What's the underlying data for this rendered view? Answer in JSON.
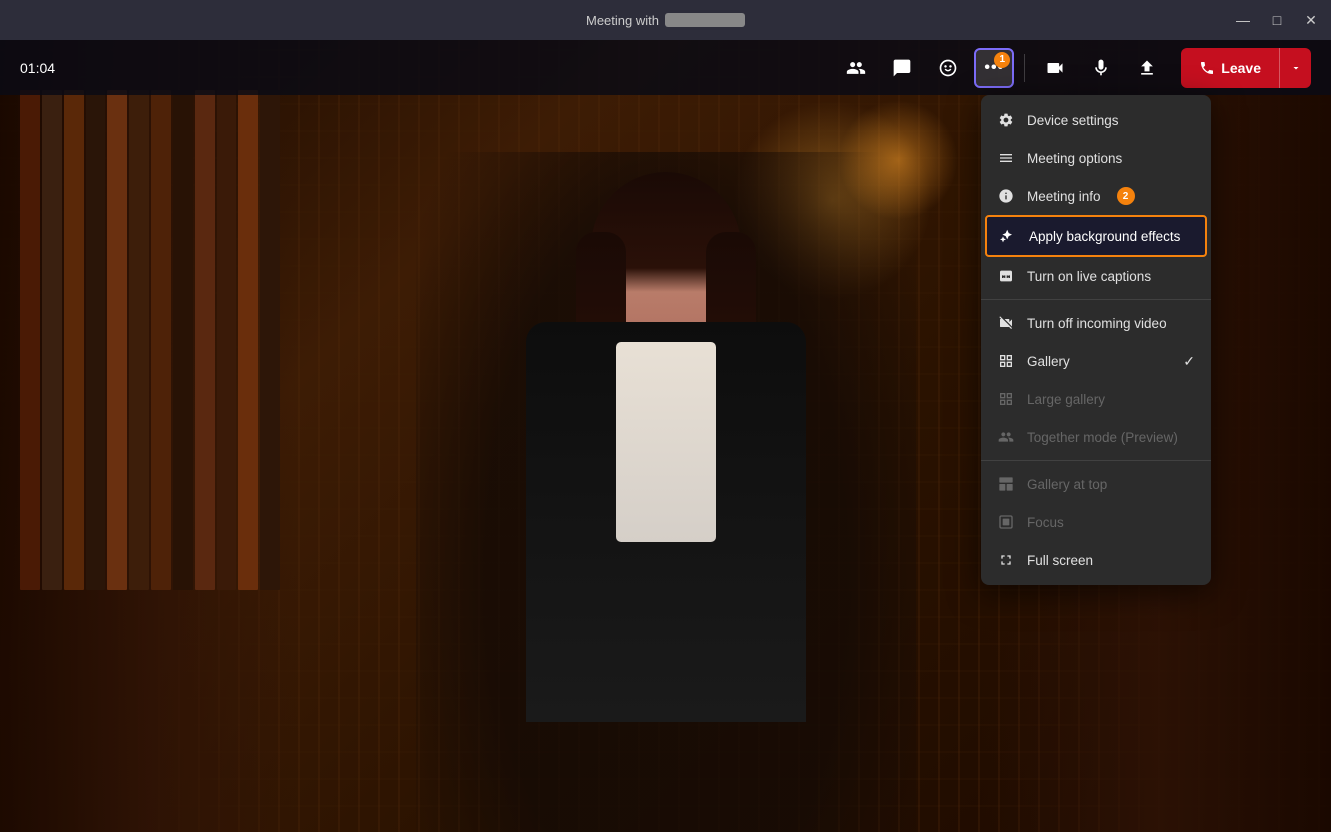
{
  "titleBar": {
    "title": "Meeting with",
    "windowControls": {
      "minimize": "—",
      "maximize": "□",
      "close": "✕"
    }
  },
  "toolbar": {
    "timer": "01:04",
    "buttons": [
      {
        "id": "people",
        "icon": "👥",
        "label": "People",
        "badge": null
      },
      {
        "id": "chat",
        "icon": "💬",
        "label": "Chat",
        "badge": null
      },
      {
        "id": "reactions",
        "icon": "✋",
        "label": "Reactions",
        "badge": null
      },
      {
        "id": "more",
        "icon": "•••",
        "label": "More",
        "badge": "1",
        "active": true
      },
      {
        "id": "camera",
        "icon": "📷",
        "label": "Camera",
        "badge": null
      },
      {
        "id": "mic",
        "icon": "🎤",
        "label": "Microphone",
        "badge": null
      },
      {
        "id": "share",
        "icon": "⬆",
        "label": "Share",
        "badge": null
      }
    ],
    "leaveButton": "Leave"
  },
  "contextMenu": {
    "items": [
      {
        "id": "device-settings",
        "label": "Device settings",
        "icon": "⚙",
        "dimmed": false,
        "highlighted": false,
        "badge": null,
        "check": null
      },
      {
        "id": "meeting-options",
        "label": "Meeting options",
        "icon": "≡",
        "dimmed": false,
        "highlighted": false,
        "badge": null,
        "check": null
      },
      {
        "id": "meeting-info",
        "label": "Meeting info",
        "icon": "ℹ",
        "dimmed": false,
        "highlighted": false,
        "badge": "2",
        "check": null
      },
      {
        "id": "apply-background",
        "label": "Apply background effects",
        "icon": "✦",
        "dimmed": false,
        "highlighted": true,
        "badge": null,
        "check": null
      },
      {
        "id": "live-captions",
        "label": "Turn on live captions",
        "icon": "💬",
        "dimmed": false,
        "highlighted": false,
        "badge": null,
        "check": null
      },
      {
        "divider": true
      },
      {
        "id": "turn-off-video",
        "label": "Turn off incoming video",
        "icon": "📷",
        "dimmed": false,
        "highlighted": false,
        "badge": null,
        "check": null
      },
      {
        "id": "gallery",
        "label": "Gallery",
        "icon": "⊞",
        "dimmed": false,
        "highlighted": false,
        "badge": null,
        "check": "✓"
      },
      {
        "id": "large-gallery",
        "label": "Large gallery",
        "icon": "⊞",
        "dimmed": true,
        "highlighted": false,
        "badge": null,
        "check": null
      },
      {
        "id": "together-mode",
        "label": "Together mode (Preview)",
        "icon": "👥",
        "dimmed": true,
        "highlighted": false,
        "badge": null,
        "check": null
      },
      {
        "divider": true
      },
      {
        "id": "gallery-top",
        "label": "Gallery at top",
        "icon": "▭",
        "dimmed": true,
        "highlighted": false,
        "badge": null,
        "check": null
      },
      {
        "id": "focus",
        "label": "Focus",
        "icon": "▭",
        "dimmed": true,
        "highlighted": false,
        "badge": null,
        "check": null
      },
      {
        "id": "full-screen",
        "label": "Full screen",
        "icon": "⊡",
        "dimmed": false,
        "highlighted": false,
        "badge": null,
        "check": null
      }
    ]
  },
  "colors": {
    "accent": "#7c6cf8",
    "badge": "#f5820d",
    "leave": "#c50f1f",
    "menuBg": "#2c2c2c",
    "highlighted": "#f5820d"
  }
}
